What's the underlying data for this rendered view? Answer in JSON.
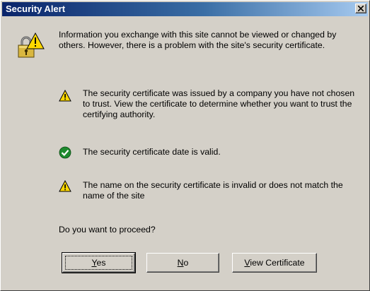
{
  "window": {
    "title": "Security Alert",
    "close_icon": "close-x-icon"
  },
  "intro": {
    "icon": "security-lock-warning-icon",
    "text": "Information you exchange with this site cannot be viewed or changed by others. However, there is a problem with the site's security certificate."
  },
  "items": [
    {
      "icon": "warning-triangle-icon",
      "text": "The security certificate was issued by a company you have not chosen to trust. View the certificate to determine whether you want to trust the certifying authority."
    },
    {
      "icon": "check-circle-icon",
      "text": "The security certificate date is valid."
    },
    {
      "icon": "warning-triangle-icon",
      "text": "The name on the security certificate is invalid or does not match the name of the site"
    }
  ],
  "question": "Do you want to proceed?",
  "buttons": {
    "yes": {
      "accel": "Y",
      "rest": "es"
    },
    "no": {
      "accel": "N",
      "rest": "o"
    },
    "view_certificate": {
      "accel": "V",
      "rest": "iew Certificate"
    }
  },
  "colors": {
    "dialog_bg": "#d4d0c8",
    "titlebar_start": "#0a246a",
    "titlebar_end": "#a6caf0",
    "warning_yellow": "#ffd800",
    "check_green": "#1e8a2e"
  }
}
